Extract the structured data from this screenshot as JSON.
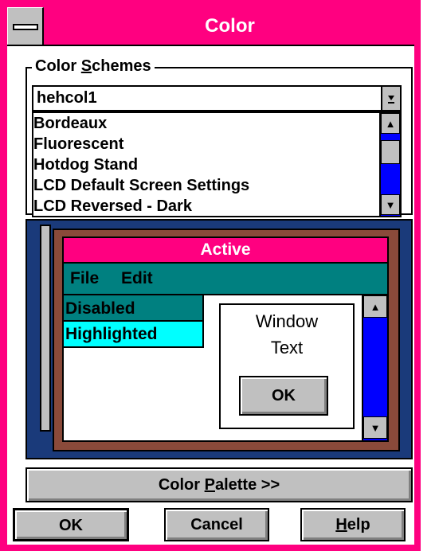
{
  "window": {
    "title": "Color"
  },
  "color_schemes": {
    "label_pre": "Color ",
    "label_accel": "S",
    "label_post": "chemes",
    "selected": "hehcol1",
    "items": [
      "Bordeaux",
      "Fluorescent",
      "Hotdog Stand",
      "LCD Default Screen Settings",
      "LCD Reversed - Dark"
    ]
  },
  "preview": {
    "active_title": "Active",
    "menu": [
      "File",
      "Edit"
    ],
    "disabled_label": "Disabled",
    "highlighted_label": "Highlighted",
    "window_text_line1": "Window",
    "window_text_line2": "Text",
    "ok_label": "OK"
  },
  "buttons": {
    "palette_pre": "Color ",
    "palette_accel": "P",
    "palette_post": "alette >>",
    "ok": "OK",
    "cancel": "Cancel",
    "help_accel": "H",
    "help_post": "elp"
  },
  "colors": {
    "title_bar": "#ff0080",
    "menu_bar": "#008080",
    "highlight": "#00ffff",
    "scrollbar": "#0000ff",
    "face": "#c0c0c0"
  },
  "icons": [
    "system-menu-icon",
    "down-arrow-icon",
    "up-arrow-icon"
  ]
}
